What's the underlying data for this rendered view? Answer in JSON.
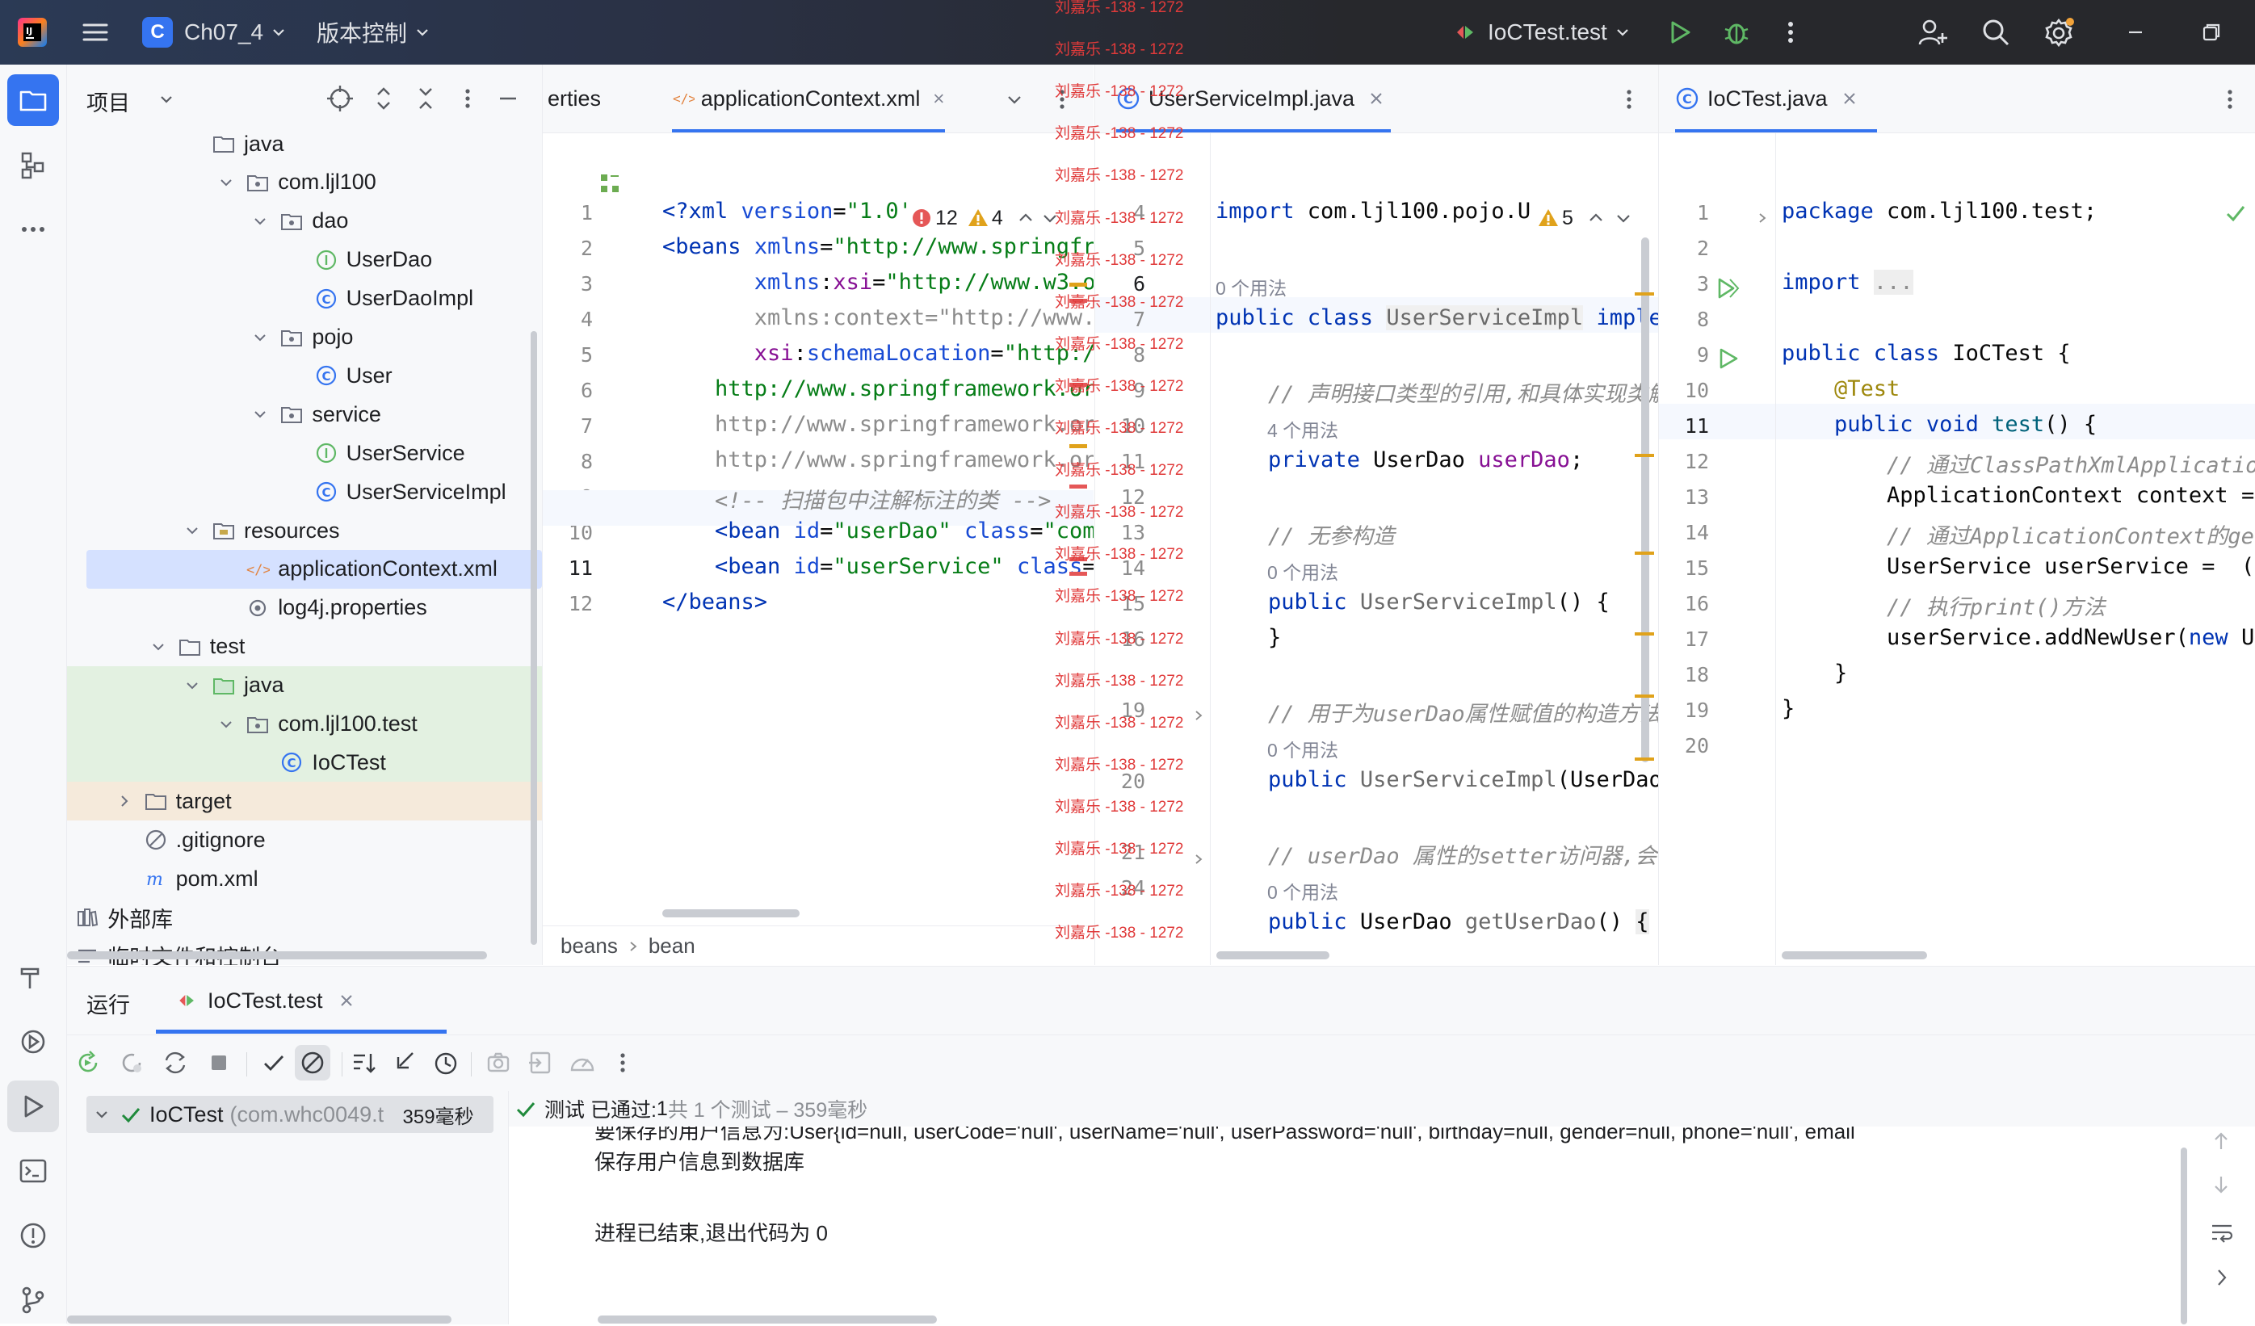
{
  "titlebar": {
    "project_initial": "C",
    "project_name": "Ch07_4",
    "vcs_label": "版本控制",
    "run_config": "IoCTest.test"
  },
  "project_pane": {
    "title": "项目",
    "tree": [
      {
        "label": "java",
        "icon": "folder-icon",
        "level": 5
      },
      {
        "label": "com.ljl100",
        "icon": "package-icon",
        "level": 6,
        "open": true
      },
      {
        "label": "dao",
        "icon": "package-icon",
        "level": 7,
        "open": true
      },
      {
        "label": "UserDao",
        "icon": "interface-icon",
        "level": 8
      },
      {
        "label": "UserDaoImpl",
        "icon": "class-icon",
        "level": 8
      },
      {
        "label": "pojo",
        "icon": "package-icon",
        "level": 7,
        "open": true
      },
      {
        "label": "User",
        "icon": "class-icon",
        "level": 8
      },
      {
        "label": "service",
        "icon": "package-icon",
        "level": 7,
        "open": true
      },
      {
        "label": "UserService",
        "icon": "interface-icon",
        "level": 8
      },
      {
        "label": "UserServiceImpl",
        "icon": "class-icon",
        "level": 8
      },
      {
        "label": "resources",
        "icon": "resources-folder-icon",
        "level": 5,
        "open": true
      },
      {
        "label": "applicationContext.xml",
        "icon": "xml-file-icon",
        "level": 6,
        "selected": true
      },
      {
        "label": "log4j.properties",
        "icon": "properties-file-icon",
        "level": 6
      },
      {
        "label": "test",
        "icon": "folder-icon",
        "level": 4,
        "open": true
      },
      {
        "label": "java",
        "icon": "test-folder-icon",
        "level": 5,
        "open": true,
        "test": true
      },
      {
        "label": "com.ljl100.test",
        "icon": "package-icon",
        "level": 6,
        "open": true,
        "test": true
      },
      {
        "label": "IoCTest",
        "icon": "class-icon",
        "level": 7,
        "test": true
      },
      {
        "label": "target",
        "icon": "folder-icon",
        "level": 3,
        "closed": true,
        "excluded": true
      },
      {
        "label": ".gitignore",
        "icon": "ignore-file-icon",
        "level": 3
      },
      {
        "label": "pom.xml",
        "icon": "maven-icon",
        "level": 3
      },
      {
        "label": "外部库",
        "icon": "library-icon",
        "level": 1,
        "closed": true
      },
      {
        "label": "临时文件和控制台",
        "icon": "scratch-icon",
        "level": 1,
        "closed": true
      }
    ]
  },
  "editor1": {
    "tab_prev": "erties",
    "tab_active": "applicationContext.xml",
    "errors": "12",
    "warnings": "4",
    "breadcrumb": [
      "beans",
      "bean"
    ],
    "line_numbers": [
      "1",
      "2",
      "3",
      "4",
      "5",
      "6",
      "7",
      "8",
      "9",
      "10",
      "11",
      "12"
    ]
  },
  "editor2": {
    "tab_active": "UserServiceImpl.java",
    "warnings": "5",
    "line_numbers": [
      "4",
      "5",
      "6",
      "7",
      "8",
      "9",
      "10",
      "11",
      "12",
      "13",
      "14",
      "15",
      "16",
      "19",
      "20",
      "21",
      "24"
    ],
    "usages_0": "0 个用法",
    "usages_4": "4 个用法"
  },
  "editor3": {
    "tab_active": "IoCTest.java",
    "line_numbers": [
      "1",
      "2",
      "3",
      "8",
      "9",
      "10",
      "11",
      "12",
      "13",
      "14",
      "15",
      "16",
      "17",
      "18",
      "19",
      "20"
    ]
  },
  "watermark": {
    "text": "刘嘉乐 -138 - 1272"
  },
  "run_panel": {
    "tab_run": "运行",
    "tab_config": "IoCTest.test",
    "tree_item": "IoCTest",
    "tree_item_pkg": "(com.whc0049.t",
    "tree_item_time": "359毫秒",
    "status_prefix": "测试 已通过: ",
    "status_count": "1",
    "status_suffix": "共 1 个测试 – 359毫秒",
    "output": [
      "要保存的用户信息为:User{id=null, userCode='null', userName='null', userPassword='null', birthday=null, gender=null, phone='null', email",
      "保存用户信息到数据库",
      "",
      "进程已结束,退出代码为 0"
    ]
  },
  "colors": {
    "accent": "#3574f0",
    "pass": "#208a3c",
    "error": "#e55757",
    "warning": "#e0a21b"
  }
}
